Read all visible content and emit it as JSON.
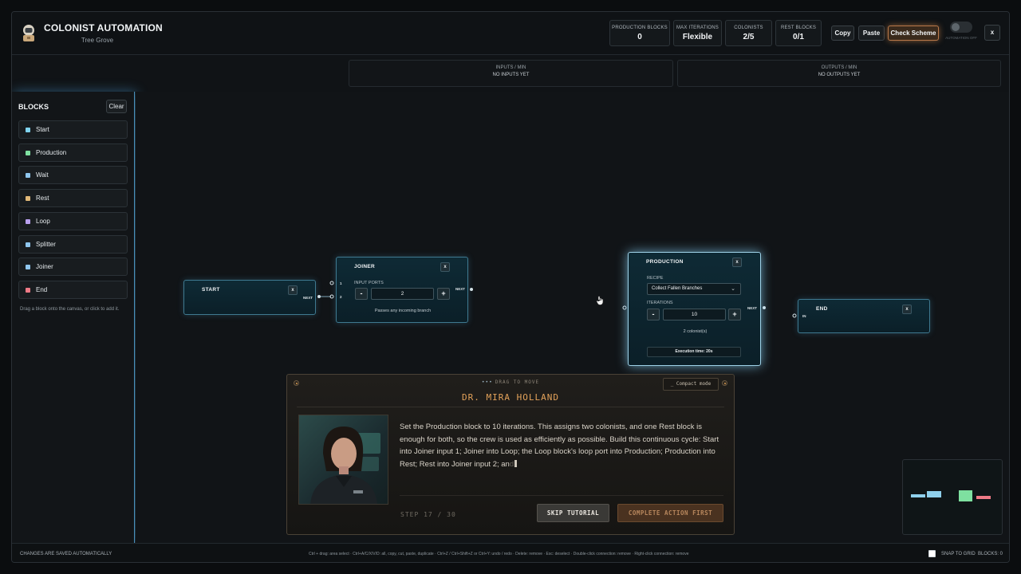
{
  "header": {
    "title": "COLONIST AUTOMATION",
    "subtitle": "Tree Grove",
    "stats": [
      {
        "label": "PRODUCTION BLOCKS",
        "value": "0"
      },
      {
        "label": "MAX ITERATIONS",
        "value": "Flexible"
      },
      {
        "label": "COLONISTS",
        "value": "2/5"
      },
      {
        "label": "REST BLOCKS",
        "value": "0/1"
      }
    ],
    "copy_label": "Copy",
    "paste_label": "Paste",
    "check_label": "Check Scheme",
    "automation_label": "AUTOMATION OFF",
    "close_label": "x"
  },
  "io": {
    "inputs_label": "INPUTS / MIN",
    "inputs_value": "NO INPUTS YET",
    "outputs_label": "OUTPUTS / MIN",
    "outputs_value": "NO OUTPUTS YET"
  },
  "sidebar": {
    "title": "BLOCKS",
    "clear_label": "Clear",
    "items": [
      {
        "label": "Start",
        "color": "#7fd3ee"
      },
      {
        "label": "Production",
        "color": "#7ee0a0"
      },
      {
        "label": "Wait",
        "color": "#8fc6ee"
      },
      {
        "label": "Rest",
        "color": "#e0b878"
      },
      {
        "label": "Loop",
        "color": "#b9a0ee"
      },
      {
        "label": "Splitter",
        "color": "#8fc6ee"
      },
      {
        "label": "Joiner",
        "color": "#8fc6ee"
      },
      {
        "label": "End",
        "color": "#ee7a86"
      }
    ],
    "hint": "Drag a block onto the canvas, or click to add it."
  },
  "nodes": {
    "start": {
      "title": "START",
      "close": "x",
      "next": "NEXT"
    },
    "joiner": {
      "title": "JOINER",
      "close": "x",
      "ports_label": "INPUT PORTS",
      "port1": "1",
      "port2": "2",
      "minus": "-",
      "plus": "+",
      "value": "2",
      "note": "Passes any incoming branch",
      "next": "NEXT"
    },
    "production": {
      "title": "PRODUCTION",
      "close": "x",
      "recipe_label": "RECIPE",
      "recipe": "Collect Fallen Branches",
      "iterations_label": "ITERATIONS",
      "minus": "-",
      "plus": "+",
      "iterations": "10",
      "colonists": "2 colonist(s)",
      "exec_time": "Execution time: 20s",
      "next": "NEXT"
    },
    "end": {
      "title": "END",
      "close": "x",
      "in": "IN"
    }
  },
  "tutorial": {
    "drag_dots": "•••",
    "drag_label": "DRAG TO MOVE",
    "compact_label": "_ Compact mode",
    "name": "DR. MIRA HOLLAND",
    "text_main": "Set the Production block to 10 iterations. This assigns two colonists, and one Rest block is enough for both, so the crew is used as efficiently as possible. Build this continuous cycle: Start into Joiner input 1; Joiner into Loop; the Loop block's loop port into Production; Production into Rest; Rest into Joiner input 2; an",
    "text_faded": "d",
    "step": "STEP 17 / 30",
    "skip_label": "SKIP TUTORIAL",
    "complete_label": "COMPLETE ACTION FIRST"
  },
  "footer": {
    "left": "CHANGES ARE SAVED AUTOMATICALLY",
    "shortcuts": "Ctrl + drag: area select · Ctrl+A/C/X/V/D: all, copy, cut, paste, duplicate · Ctrl+Z / Ctrl+Shift+Z or Ctrl+Y: undo / redo · Delete: remove · Esc: deselect · Double-click connection: remove · Right-click connection: remove",
    "snap_label": "SNAP TO GRID",
    "blocks_label": "BLOCKS: 0"
  }
}
